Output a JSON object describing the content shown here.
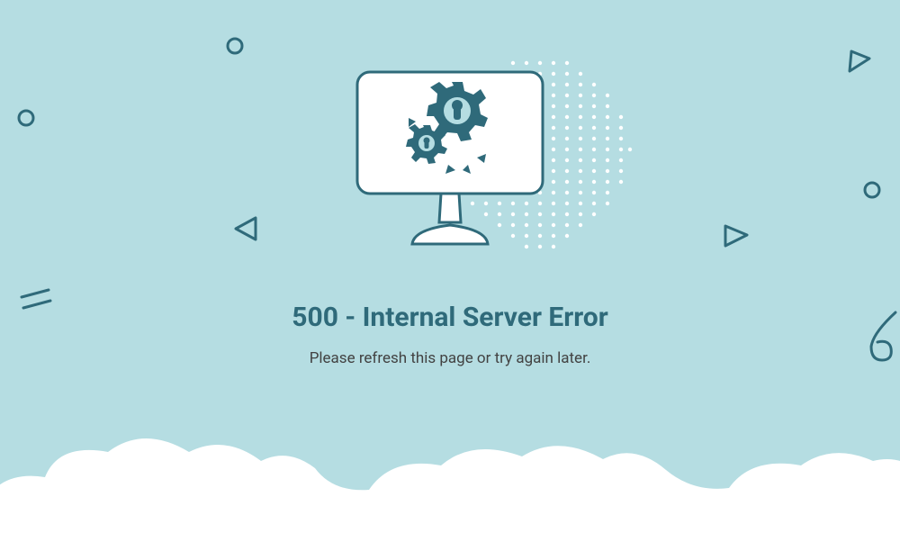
{
  "error": {
    "heading": "500 - Internal Server Error",
    "message": "Please refresh this page or try again later."
  }
}
